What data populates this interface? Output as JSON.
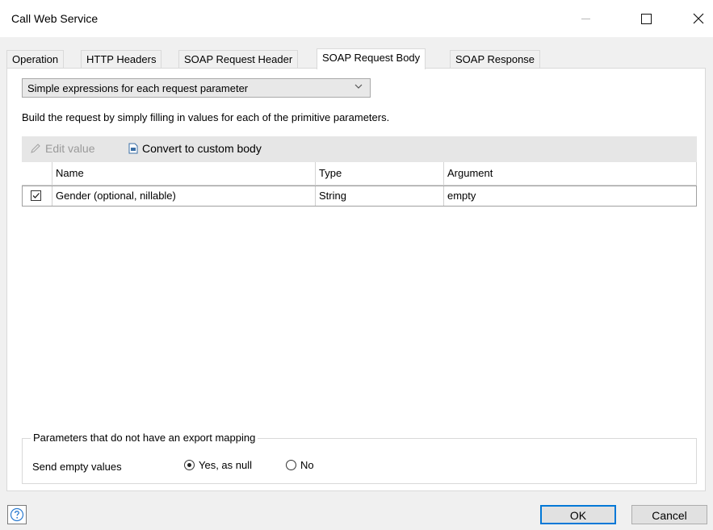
{
  "window": {
    "title": "Call Web Service"
  },
  "tabs": [
    {
      "label": "Operation"
    },
    {
      "label": "HTTP Headers"
    },
    {
      "label": "SOAP Request Header"
    },
    {
      "label": "SOAP Request Body",
      "active": true
    },
    {
      "label": "SOAP Response"
    }
  ],
  "body": {
    "mode_select": {
      "value": "Simple expressions for each request parameter"
    },
    "description": "Build the request by simply filling in values for each of the primitive parameters.",
    "toolbar": {
      "edit_label": "Edit value",
      "edit_icon": "pencil-icon",
      "convert_label": "Convert to custom body",
      "convert_icon": "document-icon"
    },
    "grid": {
      "columns": [
        "Name",
        "Type",
        "Argument"
      ],
      "rows": [
        {
          "checked": true,
          "name": "Gender (optional, nillable)",
          "type": "String",
          "argument": "empty"
        }
      ]
    },
    "export_group": {
      "legend": "Parameters that do not have an export mapping",
      "send_label": "Send empty values",
      "options": [
        {
          "label": "Yes, as null",
          "selected": true
        },
        {
          "label": "No",
          "selected": false
        }
      ]
    }
  },
  "footer": {
    "help_icon": "question-icon",
    "ok_label": "OK",
    "cancel_label": "Cancel"
  },
  "colors": {
    "accent": "#0078d7",
    "help": "#2b7bd0"
  }
}
